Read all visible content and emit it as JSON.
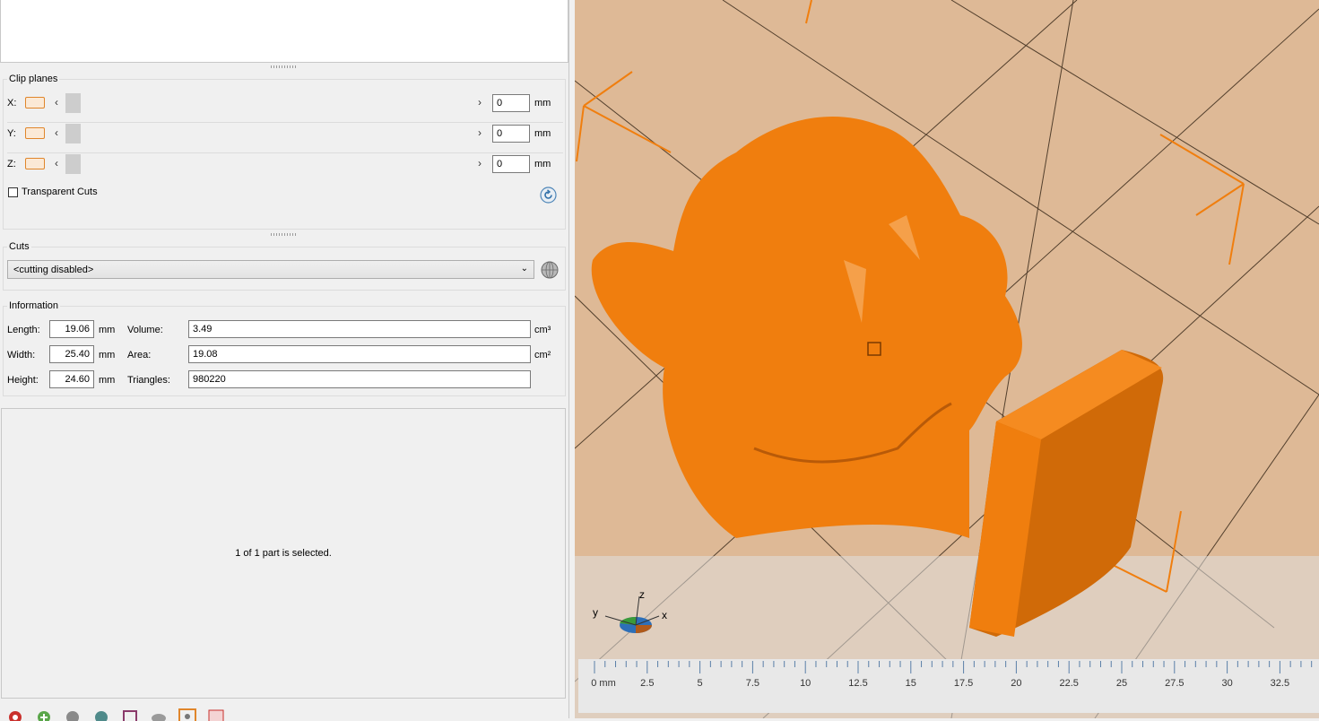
{
  "clip_planes": {
    "title": "Clip planes",
    "axes": [
      {
        "label": "X:",
        "value": "0",
        "unit": "mm"
      },
      {
        "label": "Y:",
        "value": "0",
        "unit": "mm"
      },
      {
        "label": "Z:",
        "value": "0",
        "unit": "mm"
      }
    ],
    "transparent_cuts_label": "Transparent Cuts",
    "transparent_cuts_checked": false
  },
  "cuts": {
    "title": "Cuts",
    "selected": "<cutting disabled>"
  },
  "information": {
    "title": "Information",
    "length_label": "Length:",
    "length_value": "19.06",
    "length_unit": "mm",
    "width_label": "Width:",
    "width_value": "25.40",
    "width_unit": "mm",
    "height_label": "Height:",
    "height_value": "24.60",
    "height_unit": "mm",
    "volume_label": "Volume:",
    "volume_value": "3.49",
    "volume_unit": "cm³",
    "area_label": "Area:",
    "area_value": "19.08",
    "area_unit": "cm²",
    "triangles_label": "Triangles:",
    "triangles_value": "980220"
  },
  "selection_status": "1 of 1 part is selected.",
  "axes_gizmo": {
    "z": "z",
    "y": "y",
    "x": "x"
  },
  "ruler": {
    "labels": [
      "0 mm",
      "2.5",
      "5",
      "7.5",
      "10",
      "12.5",
      "15",
      "17.5",
      "20",
      "22.5",
      "25",
      "27.5",
      "30",
      "32.5"
    ]
  },
  "colors": {
    "model": "#f07e0e",
    "build_plate": "#deb996",
    "accent": "#e0862b"
  }
}
